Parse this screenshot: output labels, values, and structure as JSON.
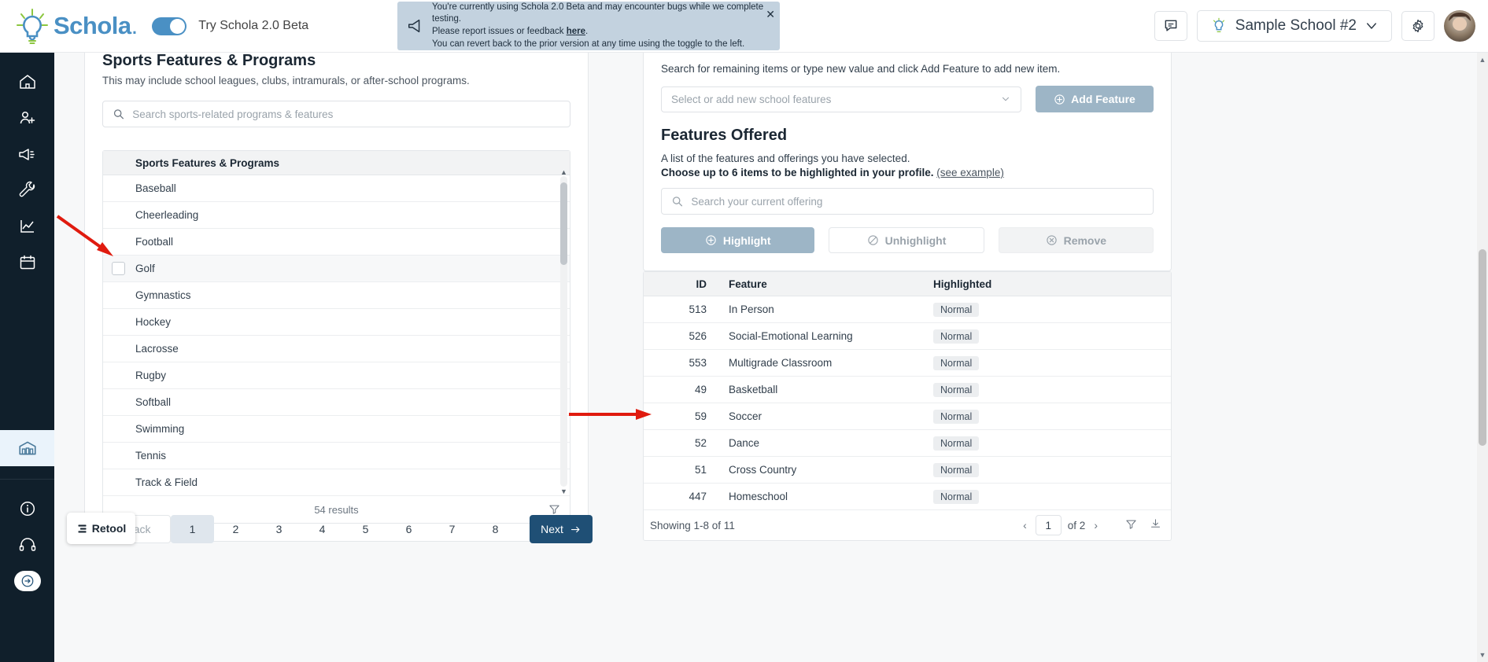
{
  "brand": {
    "name": "Schola",
    "beta_toggle_label": "Try Schola 2.0 Beta",
    "accent_blue": "#4a90c4",
    "nav_dark": "#101f2b"
  },
  "banner": {
    "line1": "You're currently using Schola 2.0 Beta and may encounter bugs while we complete testing.",
    "line2_pre": "Please report issues or feedback ",
    "line2_link": "here",
    "line2_post": ".",
    "line3": "You can revert back to the prior version at any time using the toggle to the left.",
    "close_label": "✕",
    "bg": "#c3d2df"
  },
  "header": {
    "school_name": "Sample School #2",
    "chat_icon": "chat-icon",
    "settings_icon": "gear-icon",
    "chevron_icon": "chevron-down-icon",
    "avatar_icon": "user-avatar"
  },
  "sidebar": {
    "items": [
      {
        "icon": "home-icon",
        "name": "home"
      },
      {
        "icon": "add-user-icon",
        "name": "families"
      },
      {
        "icon": "megaphone-icon",
        "name": "marketing"
      },
      {
        "icon": "wrench-icon",
        "name": "tools"
      },
      {
        "icon": "chart-line-icon",
        "name": "analytics"
      },
      {
        "icon": "calendar-icon",
        "name": "calendar"
      }
    ],
    "active_item": {
      "icon": "school-building-icon",
      "name": "school-profile"
    },
    "bottom_items": [
      {
        "icon": "info-circle-icon",
        "name": "info"
      },
      {
        "icon": "headset-icon",
        "name": "support"
      }
    ],
    "collapse_icon": "arrow-right-icon"
  },
  "left_panel": {
    "title": "Sports Features & Programs",
    "subtitle": "This may include school leagues, clubs, intramurals, or after-school programs.",
    "search_placeholder": "Search sports-related programs & features",
    "search_value": "",
    "search_icon": "search-icon",
    "table_header": "Sports Features & Programs",
    "rows": [
      {
        "label": "Baseball",
        "hover": false,
        "checkbox": false
      },
      {
        "label": "Cheerleading",
        "hover": false,
        "checkbox": false
      },
      {
        "label": "Football",
        "hover": false,
        "checkbox": false
      },
      {
        "label": "Golf",
        "hover": true,
        "checkbox": true
      },
      {
        "label": "Gymnastics",
        "hover": false,
        "checkbox": false
      },
      {
        "label": "Hockey",
        "hover": false,
        "checkbox": false
      },
      {
        "label": "Lacrosse",
        "hover": false,
        "checkbox": false
      },
      {
        "label": "Rugby",
        "hover": false,
        "checkbox": false
      },
      {
        "label": "Softball",
        "hover": false,
        "checkbox": false
      },
      {
        "label": "Swimming",
        "hover": false,
        "checkbox": false
      },
      {
        "label": "Tennis",
        "hover": false,
        "checkbox": false
      },
      {
        "label": "Track & Field",
        "hover": false,
        "checkbox": false
      }
    ],
    "results_text": "54 results",
    "filter_icon": "filter-icon"
  },
  "pagination": {
    "back_label": "Back",
    "pages": [
      "1",
      "2",
      "3",
      "4",
      "5",
      "6",
      "7",
      "8"
    ],
    "active_page": "1",
    "next_label": "Next",
    "next_icon": "arrow-right-icon"
  },
  "retool": {
    "label": "Retool",
    "icon": "retool-icon"
  },
  "right_panel": {
    "hint": "Search for remaining items or type new value and click Add Feature to add new item.",
    "select_placeholder": "Select or add new school features",
    "select_chevron": "chevron-down-icon",
    "add_feature_label": "Add Feature",
    "add_feature_icon": "plus-circle-icon",
    "title": "Features Offered",
    "desc_line1": "A list of the features and offerings you have selected.",
    "desc_line2": "Choose up to 6 items to be highlighted in your profile.",
    "see_example": "(see example)",
    "search_placeholder": "Search your current offering",
    "search_value": "",
    "search_icon": "search-icon",
    "buttons": [
      {
        "label": "Highlight",
        "icon": "plus-circle-icon",
        "style": "primary"
      },
      {
        "label": "Unhighlight",
        "icon": "no-entry-icon",
        "style": "ghost"
      },
      {
        "label": "Remove",
        "icon": "x-circle-icon",
        "style": "muted"
      }
    ]
  },
  "features_table": {
    "columns": [
      "ID",
      "Feature",
      "Highlighted"
    ],
    "rows": [
      {
        "id": "513",
        "feature": "In Person",
        "highlighted": "Normal"
      },
      {
        "id": "526",
        "feature": "Social-Emotional Learning",
        "highlighted": "Normal"
      },
      {
        "id": "553",
        "feature": "Multigrade Classroom",
        "highlighted": "Normal"
      },
      {
        "id": "49",
        "feature": "Basketball",
        "highlighted": "Normal"
      },
      {
        "id": "59",
        "feature": "Soccer",
        "highlighted": "Normal"
      },
      {
        "id": "52",
        "feature": "Dance",
        "highlighted": "Normal"
      },
      {
        "id": "51",
        "feature": "Cross Country",
        "highlighted": "Normal"
      },
      {
        "id": "447",
        "feature": "Homeschool",
        "highlighted": "Normal"
      }
    ],
    "showing": "Showing 1-8 of 11",
    "page_value": "1",
    "page_of": "of 2",
    "prev_icon": "chevron-left-icon",
    "next_icon": "chevron-right-icon",
    "filter_icon": "filter-icon",
    "download_icon": "download-icon"
  },
  "annotations": {
    "arrow_color": "#e01b0f",
    "arrow1_target": "golf-row-checkbox",
    "arrow2_target": "soccer-table-row"
  }
}
